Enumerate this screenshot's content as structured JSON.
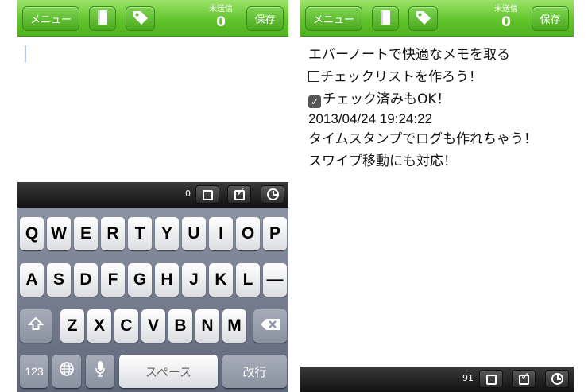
{
  "header": {
    "menu_label": "メニュー",
    "notebook_icon": "notebook-icon",
    "tag_icon": "tag-icon",
    "unsent_label": "未送信",
    "unsent_count": "0",
    "save_label": "保存"
  },
  "left_screen": {
    "toolbar": {
      "char_count": "0"
    },
    "keyboard": {
      "row1": [
        "Q",
        "W",
        "E",
        "R",
        "T",
        "Y",
        "U",
        "I",
        "O",
        "P"
      ],
      "row2": [
        "A",
        "S",
        "D",
        "F",
        "G",
        "H",
        "J",
        "K",
        "L",
        "—"
      ],
      "row3": [
        "Z",
        "X",
        "C",
        "V",
        "B",
        "N",
        "M"
      ],
      "shift_icon": "shift-icon",
      "backspace_icon": "backspace-icon",
      "numbers_label": "123",
      "globe_icon": "globe-icon",
      "mic_icon": "microphone-icon",
      "space_label": "スペース",
      "return_label": "改行"
    }
  },
  "right_screen": {
    "note": {
      "line1": "エバーノートで快適なメモを取る",
      "line2": "チェックリストを作ろう！",
      "line3": "チェック済みもOK！",
      "line4": "2013/04/24 19:24:22",
      "line5": "タイムスタンプでログも作れちゃう！",
      "line6": "スワイプ移動にも対応！"
    },
    "toolbar": {
      "char_count": "91"
    }
  },
  "colors": {
    "header_green": "#62c52c",
    "toolbar_dark": "#1c1c1c",
    "keyboard_bg": "#7a8294"
  }
}
